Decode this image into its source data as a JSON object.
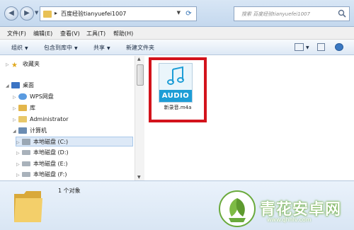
{
  "address": {
    "path": "百度经验tianyuefei1007",
    "search_placeholder": "搜索 百度经验tianyuefei1007"
  },
  "menu": [
    "文件(F)",
    "编辑(E)",
    "查看(V)",
    "工具(T)",
    "帮助(H)"
  ],
  "toolbar": {
    "organize": "组织",
    "include_in_library": "包含到库中",
    "share": "共享",
    "new_folder": "新建文件夹"
  },
  "nav": {
    "favorites": "收藏夹",
    "desktop": "桌面",
    "wps": "WPS网盘",
    "libraries": "库",
    "administrator": "Administrator",
    "computer": "计算机",
    "drives": [
      "本地磁盘 (C:)",
      "本地磁盘 (D:)",
      "本地磁盘 (E:)",
      "本地磁盘 (F:)"
    ]
  },
  "file": {
    "badge": "AUDIO",
    "name": "新录音.m4a"
  },
  "status": {
    "count": "1 个对象"
  },
  "watermark": {
    "name": "青花安卓网",
    "url": "www.qhhlv.com"
  },
  "colors": {
    "highlight": "#d3131c",
    "audio_band": "#1d9dd6",
    "folder": "#e8c155"
  }
}
